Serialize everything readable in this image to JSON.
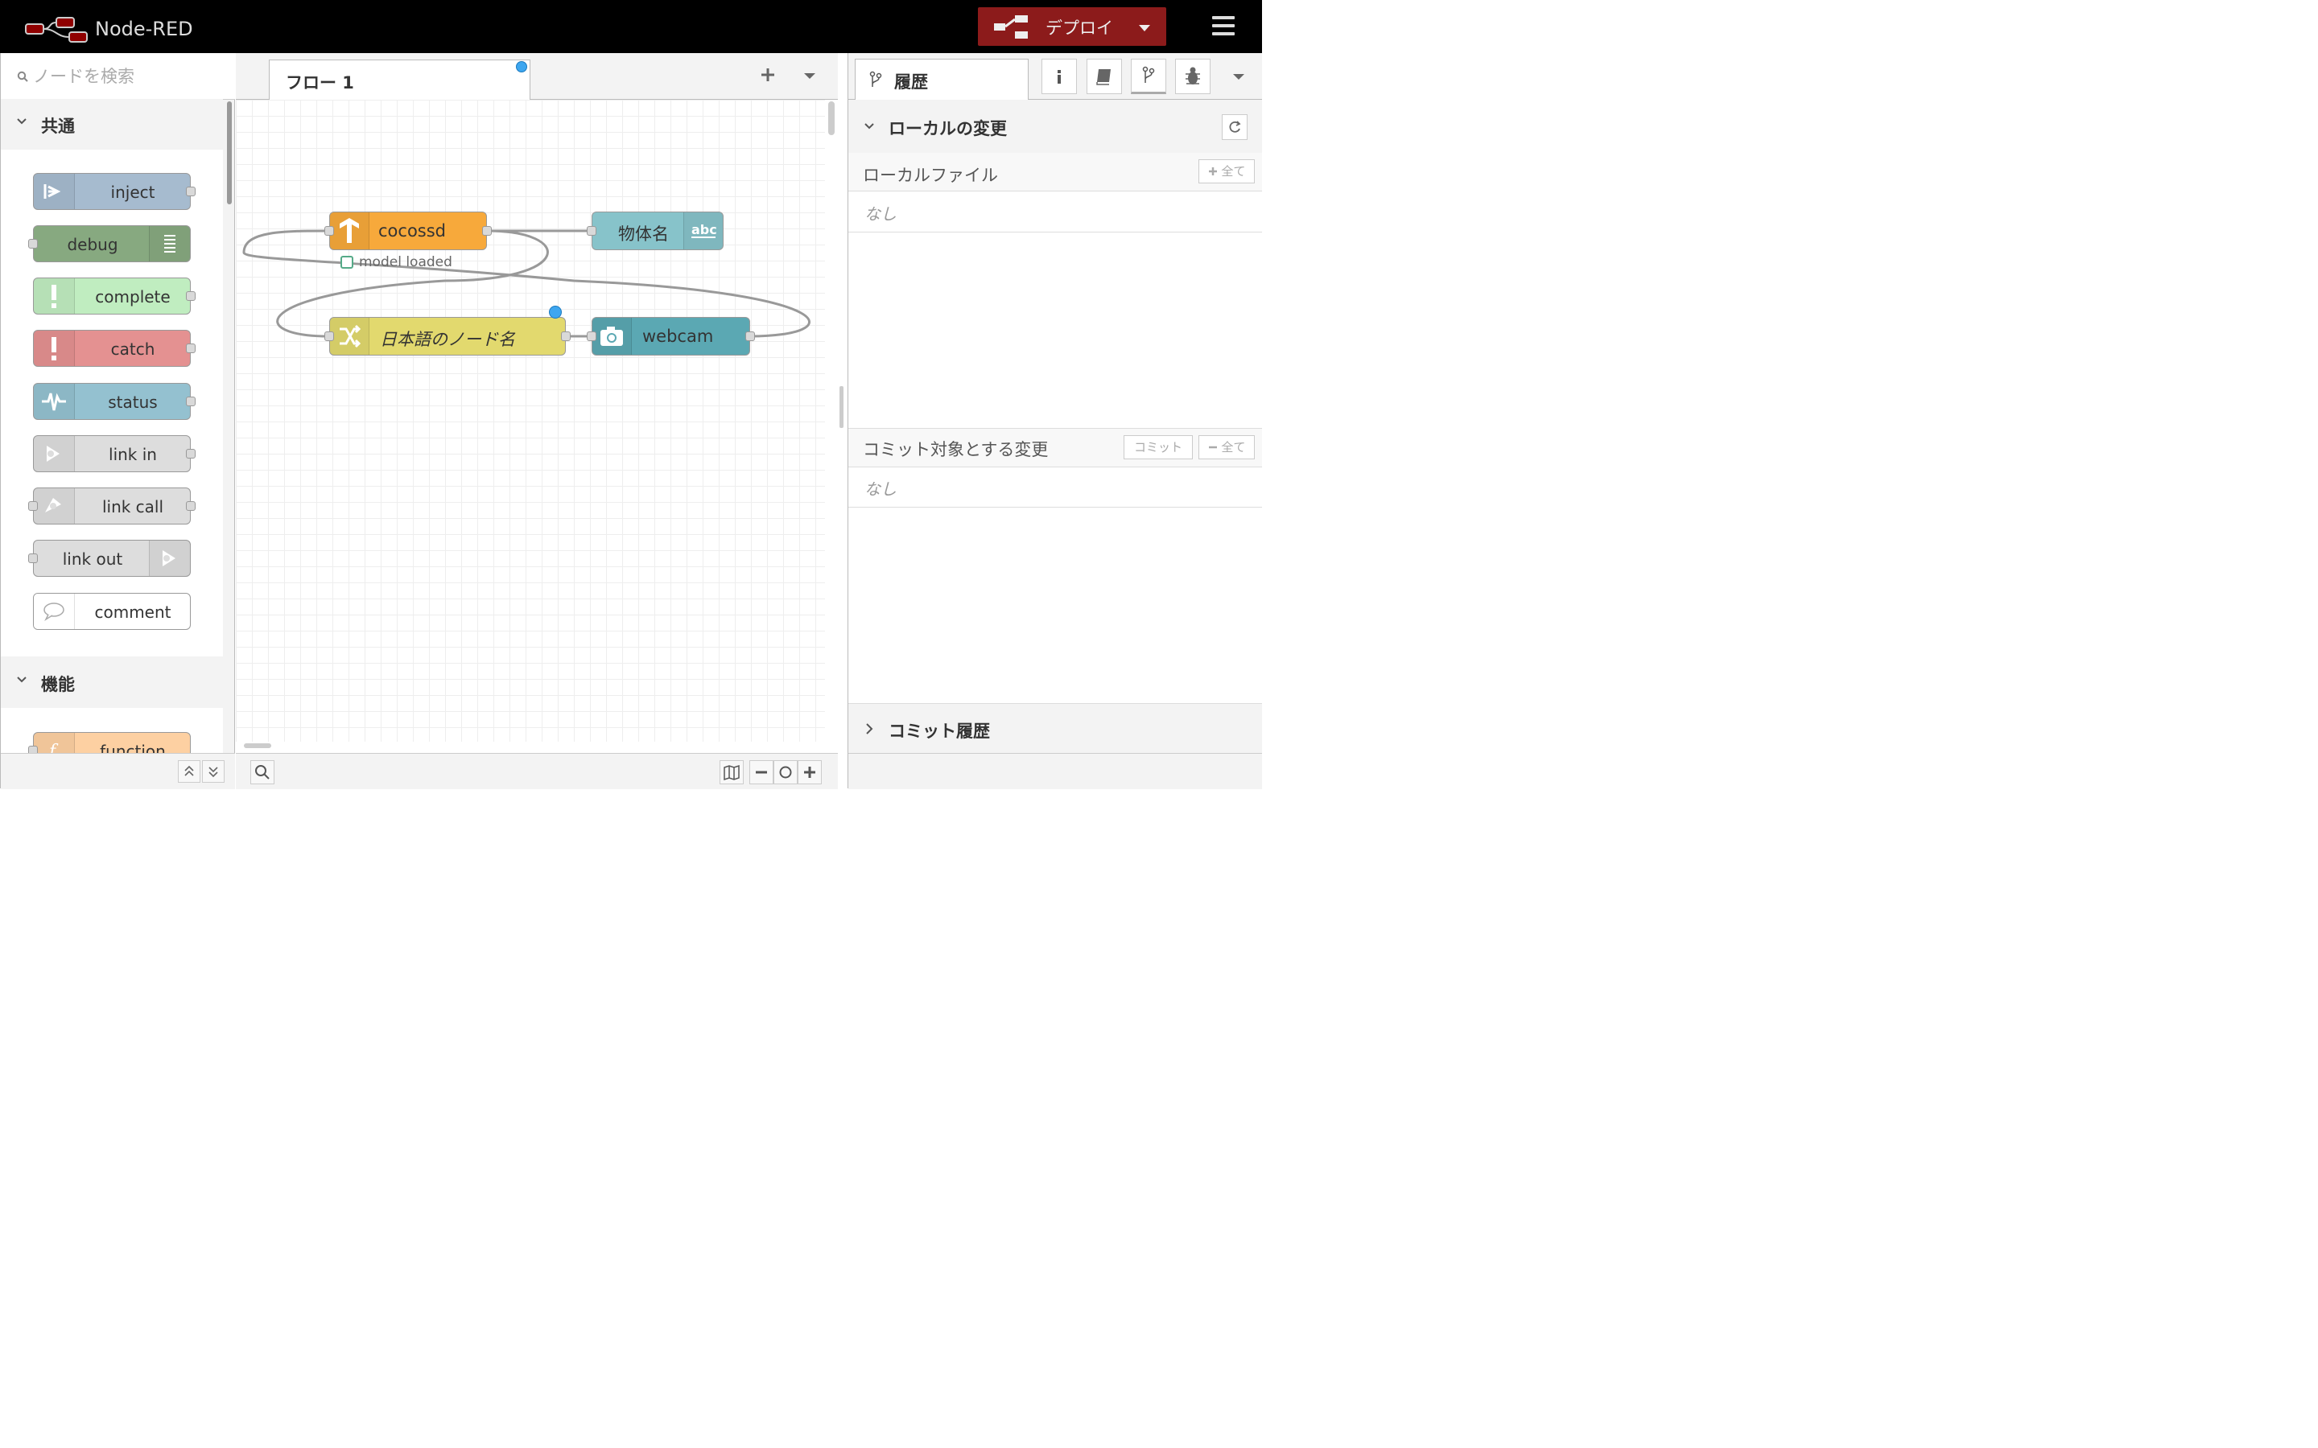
{
  "header": {
    "app_title": "Node-RED",
    "deploy_label": "デプロイ",
    "brand_color": "#8c1b1b"
  },
  "palette": {
    "search_placeholder": "ノードを検索",
    "categories": [
      {
        "title": "共通",
        "nodes": [
          {
            "label": "inject",
            "color": "#a6bbcf"
          },
          {
            "label": "debug",
            "color": "#87a980"
          },
          {
            "label": "complete",
            "color": "#c0edc0"
          },
          {
            "label": "catch",
            "color": "#e49191"
          },
          {
            "label": "status",
            "color": "#94c1d0"
          },
          {
            "label": "link in",
            "color": "#dddddd"
          },
          {
            "label": "link call",
            "color": "#dddddd"
          },
          {
            "label": "link out",
            "color": "#dddddd"
          },
          {
            "label": "comment",
            "color": "#ffffff"
          }
        ]
      },
      {
        "title": "機能",
        "nodes": [
          {
            "label": "function",
            "color": "#fdd0a2"
          }
        ]
      }
    ]
  },
  "workspace": {
    "tab_label": "フロー 1",
    "nodes": [
      {
        "label": "cocossd",
        "color": "#f7a93b",
        "status": "model loaded"
      },
      {
        "label": "物体名",
        "color": "#87c3ca"
      },
      {
        "label": "日本語のノード名",
        "color": "#e2d96e"
      },
      {
        "label": "webcam",
        "color": "#5ba8b3"
      }
    ]
  },
  "sidebar": {
    "tab_label": "履歴",
    "local_changes": {
      "title": "ローカルの変更",
      "local_files_label": "ローカルファイル",
      "add_all_label": "全て",
      "none_text": "なし"
    },
    "commit_changes": {
      "label": "コミット対象とする変更",
      "commit_label": "コミット",
      "remove_all_label": "全て",
      "none_text": "なし"
    },
    "commit_history": {
      "title": "コミット履歴"
    }
  }
}
